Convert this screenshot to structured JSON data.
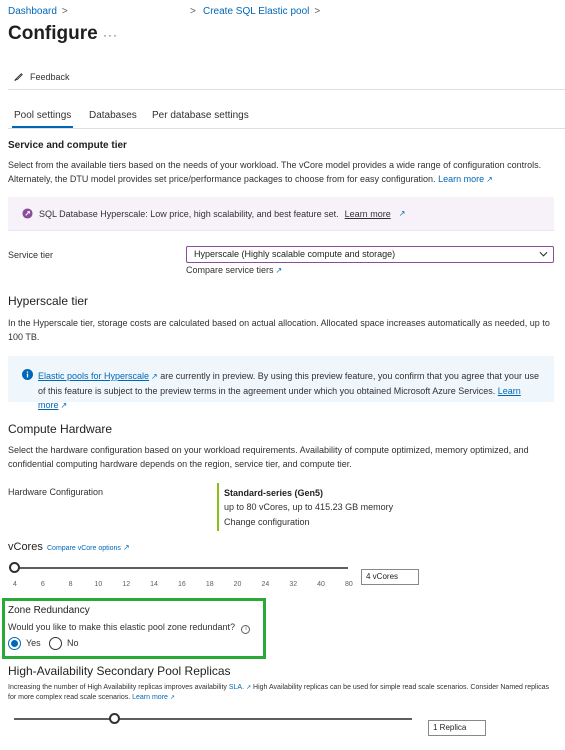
{
  "breadcrumb": {
    "dashboard": "Dashboard",
    "create_pool": "Create SQL Elastic pool",
    "separator": ">"
  },
  "page": {
    "title": "Configure",
    "more": "···"
  },
  "toolbar": {
    "feedback": "Feedback"
  },
  "tabs": [
    "Pool settings",
    "Databases",
    "Per database settings"
  ],
  "service": {
    "heading": "Service and compute tier",
    "description": "Select from the available tiers based on the needs of your workload. The vCore model provides a wide range of configuration controls. Alternately, the DTU model provides set price/performance packages to choose from for easy configuration.",
    "learn_more": "Learn more",
    "promo_text": "SQL Database Hyperscale: Low price, high scalability, and best feature set.",
    "promo_learn_more": "Learn more",
    "tier_label": "Service tier",
    "tier_value": "Hyperscale (Highly scalable compute and storage)",
    "compare_link": "Compare service tiers"
  },
  "hyperscale": {
    "heading": "Hyperscale tier",
    "description": "In the Hyperscale tier, storage costs are calculated based on actual allocation. Allocated space increases automatically as needed, up to 100 TB.",
    "info_link": "Elastic pools for Hyperscale",
    "info_text": "are currently in preview. By using this preview feature, you confirm that you agree that your use of this feature is subject to the preview terms in the agreement under which you obtained Microsoft Azure Services.",
    "info_learn_more": "Learn more"
  },
  "compute": {
    "heading": "Compute Hardware",
    "description": "Select the hardware configuration based on your workload requirements. Availability of compute optimized, memory optimized, and confidential computing hardware depends on the region, service tier, and compute tier.",
    "hw_label": "Hardware Configuration",
    "hw_name": "Standard-series (Gen5)",
    "hw_detail": "up to 80 vCores, up to 415.23 GB memory",
    "hw_change": "Change configuration"
  },
  "vcores": {
    "label": "vCores",
    "compare_link": "Compare vCore options",
    "ticks": [
      "4",
      "6",
      "8",
      "10",
      "12",
      "14",
      "16",
      "18",
      "20",
      "24",
      "32",
      "40",
      "80"
    ],
    "value_text": "4 vCores",
    "position": 0
  },
  "zone": {
    "heading": "Zone Redundancy",
    "question": "Would you like to make this elastic pool zone redundant?",
    "info_icon": "i",
    "yes": "Yes",
    "no": "No",
    "selected": "Yes"
  },
  "ha": {
    "heading": "High-Availability Secondary Pool Replicas",
    "description_1": "Increasing the number of High Availability replicas improves availability",
    "sla_link": "SLA.",
    "description_2": "High Availability replicas can be used for simple read scale scenarios. Consider Named replicas for more complex read scale scenarios.",
    "learn_more": "Learn more",
    "value_text": "1 Replica",
    "position": 0.25
  },
  "colors": {
    "link": "#0067b8",
    "accent": "#0067b8",
    "highlight_border": "#2aa838",
    "select_border": "#8b4c9b",
    "hardware_bar": "#8cbd18"
  },
  "icons": {
    "feedback": "feedback-icon",
    "rocket": "rocket-icon",
    "info": "info-icon",
    "external_link": "external-link-icon",
    "chevron": "chevron-down-icon"
  }
}
